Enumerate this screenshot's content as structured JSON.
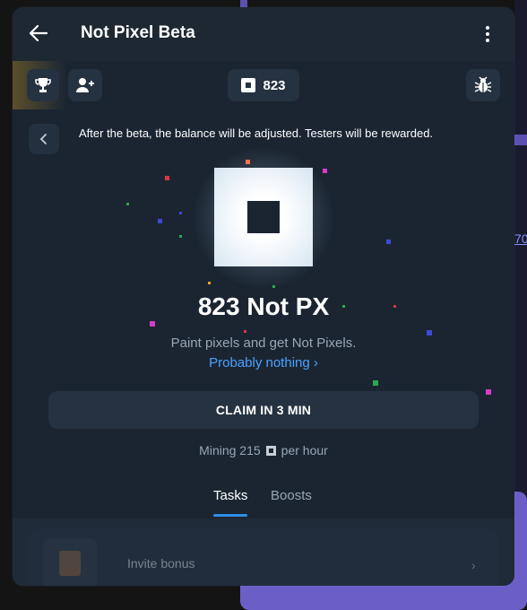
{
  "app": {
    "title": "Not Pixel Beta",
    "balance": "823"
  },
  "notice": {
    "text": "After the beta, the balance will be adjusted. Testers will be rewarded."
  },
  "hero": {
    "amount": "823 Not PX",
    "subtitle": "Paint pixels and get Not Pixels.",
    "link": "Probably nothing ›"
  },
  "claim": {
    "label": "CLAIM IN 3 MIN"
  },
  "mining": {
    "prefix": "Mining 215",
    "suffix": "per hour"
  },
  "tabs": [
    {
      "label": "Tasks",
      "active": true
    },
    {
      "label": "Boosts",
      "active": false
    }
  ],
  "tasks": [
    {
      "label": "Invite bonus"
    }
  ],
  "background": {
    "partial_text": "70"
  },
  "colors": {
    "accent": "#2f8fe6",
    "link": "#4aa3ff",
    "panel": "#1b2532",
    "button": "#253241"
  },
  "icons": {
    "back": "arrow-left-icon",
    "more": "kebab-menu-icon",
    "trophy": "trophy-icon",
    "invite": "add-user-icon",
    "balance": "pixel-coin-icon",
    "bug": "bug-icon",
    "notice_back": "chevron-left-icon"
  }
}
